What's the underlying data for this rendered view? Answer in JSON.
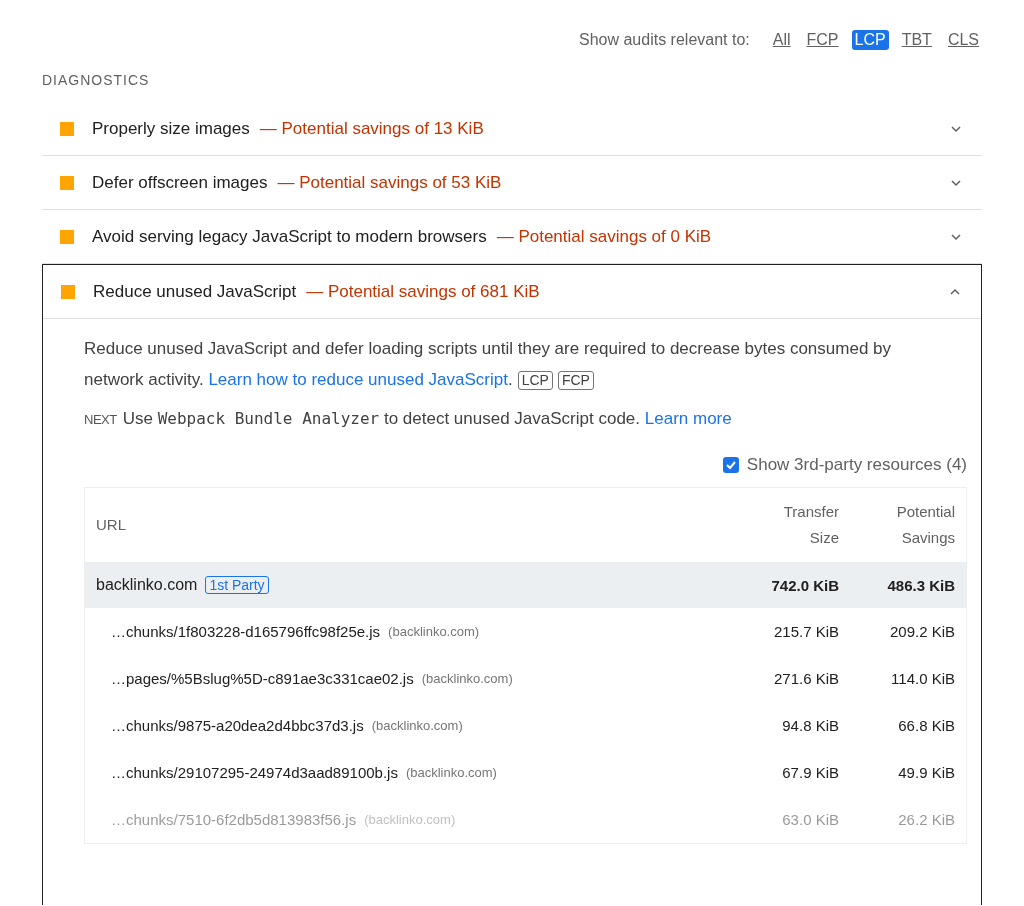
{
  "filter": {
    "label": "Show audits relevant to:",
    "options": [
      {
        "label": "All",
        "selected": false
      },
      {
        "label": "FCP",
        "selected": false
      },
      {
        "label": "LCP",
        "selected": true
      },
      {
        "label": "TBT",
        "selected": false
      },
      {
        "label": "CLS",
        "selected": false
      }
    ]
  },
  "section_title": "DIAGNOSTICS",
  "audits": [
    {
      "title": "Properly size images",
      "savings": "— Potential savings of 13 KiB",
      "expanded": false
    },
    {
      "title": "Defer offscreen images",
      "savings": "— Potential savings of 53 KiB",
      "expanded": false
    },
    {
      "title": "Avoid serving legacy JavaScript to modern browsers",
      "savings": "— Potential savings of 0 KiB",
      "expanded": false
    },
    {
      "title": "Reduce unused JavaScript",
      "savings": "— Potential savings of 681 KiB",
      "expanded": true
    }
  ],
  "details": {
    "description": "Reduce unused JavaScript and defer loading scripts until they are required to decrease bytes consumed by network activity.",
    "link": "Learn how to reduce unused JavaScript",
    "link_end": ".",
    "tags": [
      "LCP",
      "FCP"
    ],
    "stack_pack": {
      "logo": "NEXT",
      "before": "Use",
      "code": "Webpack Bundle Analyzer",
      "after": "to detect unused JavaScript code.",
      "link": "Learn more"
    },
    "third_party": {
      "label": "Show 3rd-party resources (4)",
      "checked": true
    },
    "table": {
      "columns": [
        "URL",
        "Transfer Size",
        "Potential Savings"
      ],
      "group": {
        "domain": "backlinko.com",
        "badge": "1st Party",
        "transfer": "742.0 KiB",
        "savings": "486.3 KiB"
      },
      "rows": [
        {
          "url": "…chunks/1f803228-d165796ffc98f25e.js",
          "host": "(backlinko.com)",
          "transfer": "215.7 KiB",
          "savings": "209.2 KiB",
          "faded": false
        },
        {
          "url": "…pages/%5Bslug%5D-c891ae3c331cae02.js",
          "host": "(backlinko.com)",
          "transfer": "271.6 KiB",
          "savings": "114.0 KiB",
          "faded": false
        },
        {
          "url": "…chunks/9875-a20dea2d4bbc37d3.js",
          "host": "(backlinko.com)",
          "transfer": "94.8 KiB",
          "savings": "66.8 KiB",
          "faded": false
        },
        {
          "url": "…chunks/29107295-24974d3aad89100b.js",
          "host": "(backlinko.com)",
          "transfer": "67.9 KiB",
          "savings": "49.9 KiB",
          "faded": false
        },
        {
          "url": "…chunks/7510-6f2db5d813983f56.js",
          "host": "(backlinko.com)",
          "transfer": "63.0 KiB",
          "savings": "26.2 KiB",
          "faded": true
        }
      ]
    }
  }
}
